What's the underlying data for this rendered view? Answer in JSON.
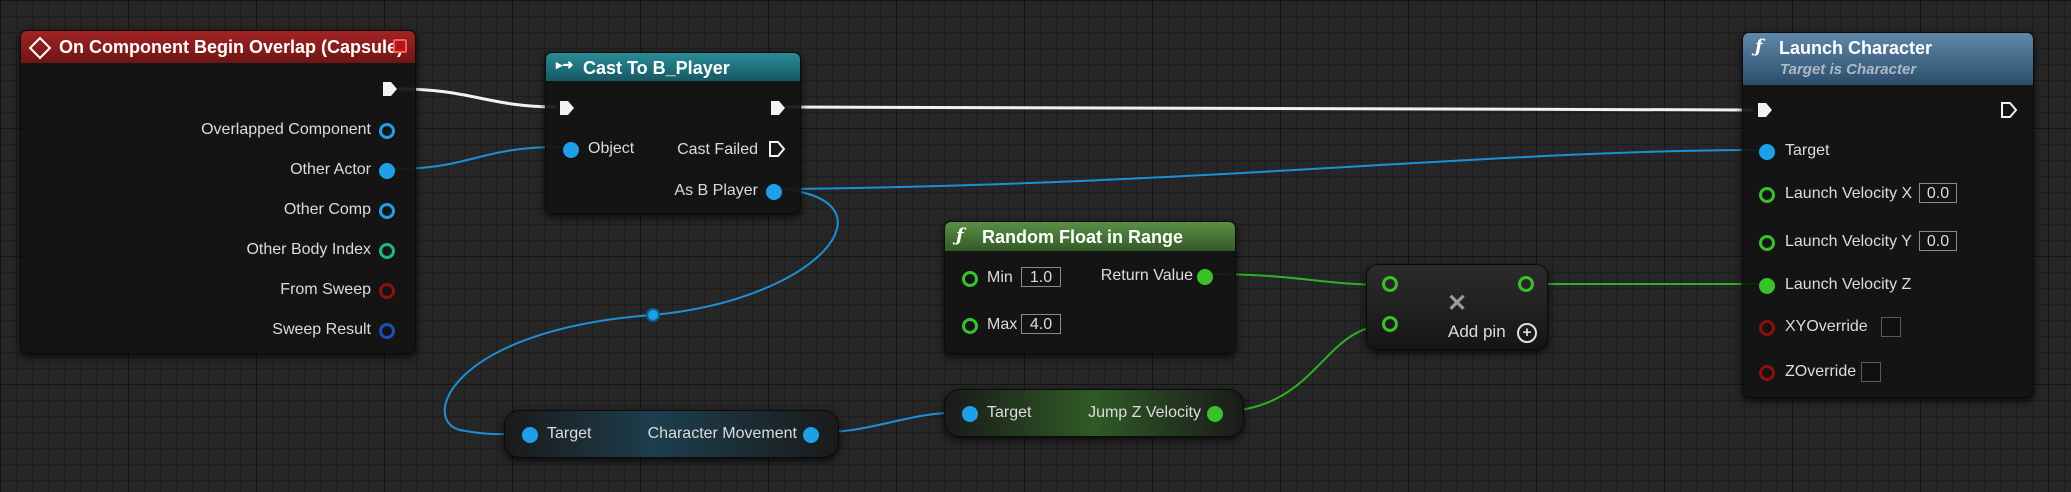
{
  "colors": {
    "event_header": "#8c1b1b",
    "cast_header": "#1d6f7a",
    "pure_func_header": "#4b7c3a",
    "func_header": "#3f6688",
    "object_pin": "#1ea0e6",
    "float_pin": "#39c12a",
    "bool_pin": "#8e0f0f",
    "vector_pin": "#1a4fb8",
    "int_pin": "#1fb58d"
  },
  "event_node": {
    "title": "On Component Begin Overlap (Capsule)",
    "icon": "event-diamond-icon",
    "pins": [
      "Overlapped Component",
      "Other Actor",
      "Other Comp",
      "Other Body Index",
      "From Sweep",
      "Sweep Result"
    ]
  },
  "cast_node": {
    "title": "Cast To B_Player",
    "in_object": "Object",
    "cast_failed": "Cast Failed",
    "as_output": "As B Player"
  },
  "get_movement_node": {
    "target": "Target",
    "output": "Character Movement"
  },
  "jump_node": {
    "target": "Target",
    "output": "Jump Z Velocity"
  },
  "random_node": {
    "title": "Random Float in Range",
    "icon": "function-f-icon",
    "min_label": "Min",
    "min_value": "1.0",
    "max_label": "Max",
    "max_value": "4.0",
    "return_label": "Return Value"
  },
  "multiply_node": {
    "operator_icon": "multiply-x-icon",
    "add_pin": "Add pin"
  },
  "launch_node": {
    "title": "Launch Character",
    "subtitle": "Target is Character",
    "icon": "function-f-icon",
    "target": "Target",
    "vel_x_label": "Launch Velocity X",
    "vel_x_value": "0.0",
    "vel_y_label": "Launch Velocity Y",
    "vel_y_value": "0.0",
    "vel_z_label": "Launch Velocity Z",
    "xy_override": "XYOverride",
    "z_override": "ZOverride"
  }
}
